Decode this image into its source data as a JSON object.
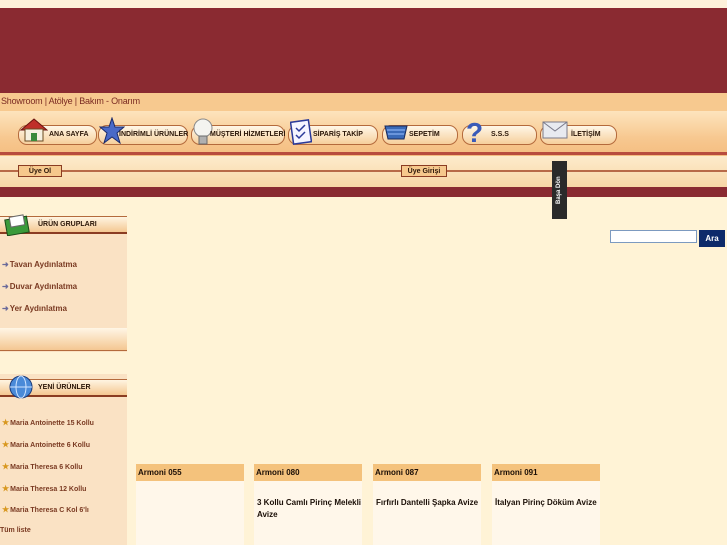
{
  "links_bar": {
    "text": "Showroom | Atölye | Bakım - Onarım"
  },
  "nav": {
    "items": [
      {
        "label": "ANA SAYFA",
        "icon": "house-icon"
      },
      {
        "label": "İNDİRİMLİ ÜRÜNLER",
        "icon": "star-icon"
      },
      {
        "label": "MÜŞTERİ HİZMETLERİ",
        "icon": "lightbulb-icon"
      },
      {
        "label": "SİPARİŞ TAKİP",
        "icon": "clipboard-icon"
      },
      {
        "label": "SEPETİM",
        "icon": "basket-icon"
      },
      {
        "label": "S.S.S",
        "icon": "question-icon"
      },
      {
        "label": "İLETİŞİM",
        "icon": "envelope-icon"
      }
    ]
  },
  "user": {
    "signup": "Üye Ol",
    "login": "Üye Girişi",
    "back_top": "Başa Dön"
  },
  "search": {
    "placeholder": "",
    "button": "Ara"
  },
  "product_groups": {
    "title": "ÜRÜN GRUPLARI",
    "items": [
      "Tavan Aydınlatma",
      "Duvar Aydınlatma",
      "Yer Aydınlatma"
    ]
  },
  "new_products": {
    "title": "YENİ ÜRÜNLER",
    "items": [
      "Maria Antoinette 15 Kollu",
      "Maria Antoinette 6 Kollu",
      "Maria Theresa 6 Kollu",
      "Maria Theresa 12 Kollu",
      "Maria Theresa C Kol 6'lı"
    ],
    "all_link": "Tüm liste"
  },
  "products": [
    {
      "code": "Armoni 055",
      "name": ""
    },
    {
      "code": "Armoni 080",
      "name": "3 Kollu Camlı Pirinç Melekli Avize"
    },
    {
      "code": "Armoni 087",
      "name": "Fırfırlı Dantelli Şapka Avize"
    },
    {
      "code": "Armoni 091",
      "name": "İtalyan Pirinç Döküm Avize"
    }
  ],
  "colors": {
    "brand": "#8a2a31",
    "accent": "#f4c27c",
    "background": "#fff3d6"
  }
}
